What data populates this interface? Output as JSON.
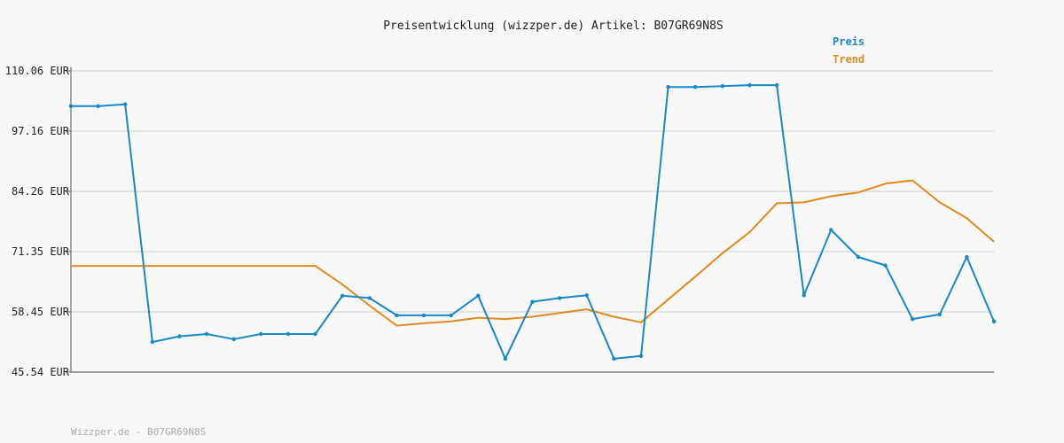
{
  "chart_data": {
    "type": "line",
    "title": "Preisentwicklung (wizzper.de) Artikel: B07GR69N8S",
    "footer": "Wizzper.de - B07GR69N8S",
    "y_unit": "EUR",
    "ylim": [
      45.54,
      110.06
    ],
    "yticks": [
      110.06,
      97.16,
      84.26,
      71.35,
      58.45,
      45.54
    ],
    "ytick_labels": [
      "110.06 EUR",
      "97.16 EUR",
      "84.26 EUR",
      "71.35 EUR",
      "58.45 EUR",
      "45.54 EUR"
    ],
    "grid": true,
    "legend_position": "top-right",
    "series": [
      {
        "name": "Preis",
        "color": "#1a87c6",
        "markers": true,
        "values": [
          102.5,
          102.5,
          102.9,
          52.0,
          53.2,
          53.7,
          52.6,
          53.7,
          53.7,
          53.7,
          61.9,
          61.4,
          57.7,
          57.7,
          57.7,
          61.9,
          48.4,
          60.6,
          61.4,
          62.0,
          48.4,
          49.0,
          106.6,
          106.6,
          106.8,
          107.0,
          107.0,
          62.0,
          76.0,
          70.2,
          68.4,
          56.9,
          57.9,
          70.2,
          56.4
        ]
      },
      {
        "name": "Trend",
        "color": "#e08a20",
        "markers": false,
        "values": [
          68.3,
          68.3,
          68.3,
          68.3,
          68.3,
          68.3,
          68.3,
          68.3,
          68.3,
          68.3,
          64.3,
          59.8,
          55.5,
          56.0,
          56.4,
          57.2,
          56.9,
          57.4,
          58.2,
          59.0,
          57.4,
          56.2,
          61.1,
          66.0,
          71.0,
          75.5,
          81.7,
          81.9,
          83.2,
          84.0,
          85.9,
          86.6,
          81.9,
          78.5,
          73.5
        ]
      }
    ]
  }
}
